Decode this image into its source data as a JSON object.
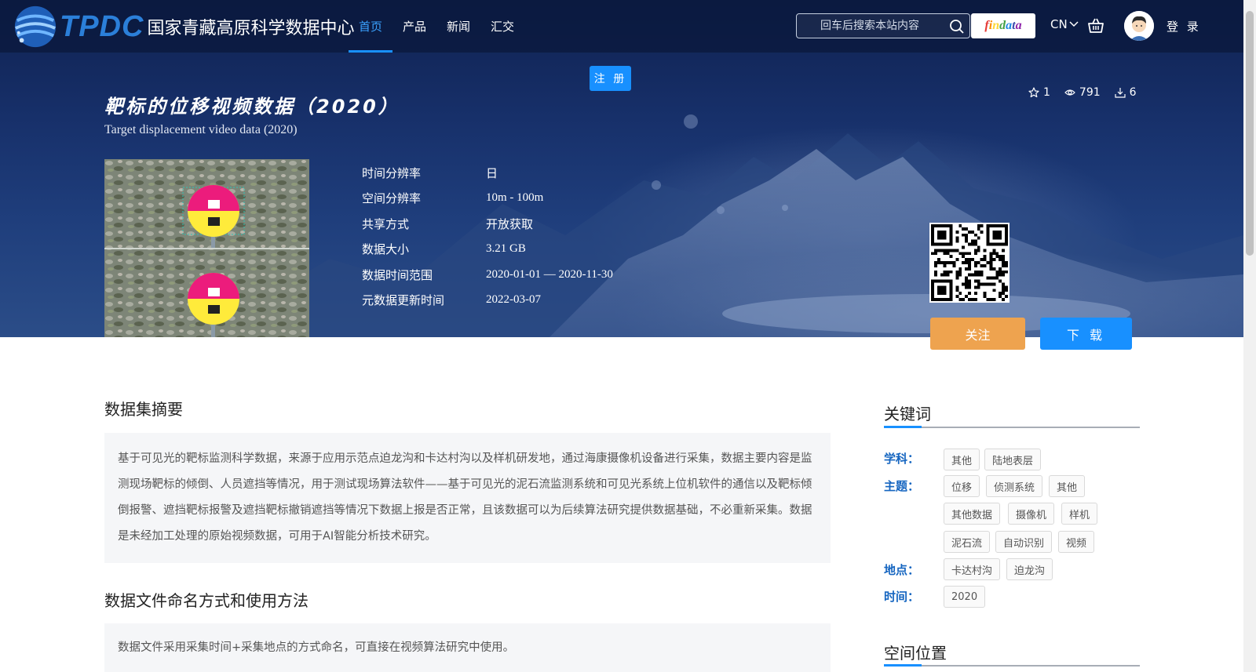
{
  "nav": {
    "logo_tpdc": "TPDC",
    "logo_cn": "国家青藏高原科学数据中心",
    "menu": [
      {
        "label": "首页",
        "active": true
      },
      {
        "label": "产品",
        "active": false
      },
      {
        "label": "新闻",
        "active": false
      },
      {
        "label": "汇交",
        "active": false
      }
    ],
    "search_placeholder": "回车后搜索本站内容",
    "findata_letters": [
      "f",
      "i",
      "n",
      "d",
      "a",
      "t",
      "a"
    ],
    "lang": "CN",
    "login": "登 录",
    "register": "注 册"
  },
  "dataset": {
    "title_cn": "靶标的位移视频数据（2020）",
    "title_en": "Target displacement video data (2020)",
    "stats": {
      "stars": "1",
      "views": "791",
      "downloads": "6"
    },
    "meta": [
      {
        "key": "时间分辨率",
        "value": "日"
      },
      {
        "key": "空间分辨率",
        "value": "10m - 100m"
      },
      {
        "key": "共享方式",
        "value": "开放获取"
      },
      {
        "key": "数据大小",
        "value": "3.21 GB"
      },
      {
        "key": "数据时间范围",
        "value": "2020-01-01 — 2020-11-30"
      },
      {
        "key": "元数据更新时间",
        "value": "2022-03-07"
      }
    ],
    "follow": "关注",
    "download": "下 载"
  },
  "abstract": {
    "title": "数据集摘要",
    "text": "基于可见光的靶标监测科学数据，来源于应用示范点迫龙沟和卡达村沟以及样机研发地，通过海康摄像机设备进行采集，数据主要内容是监测现场靶标的倾倒、人员遮挡等情况，用于测试现场算法软件——基于可见光的泥石流监测系统和可见光系统上位机软件的通信以及靶标倾倒报警、遮挡靶标报警及遮挡靶标撤销遮挡等情况下数据上报是否正常，且该数据可以为后续算法研究提供数据基础，不必重新采集。数据是未经加工处理的原始视频数据，可用于AI智能分析技术研究。"
  },
  "usage": {
    "title": "数据文件命名方式和使用方法",
    "text": "数据文件采用采集时间+采集地点的方式命名，可直接在视频算法研究中使用。"
  },
  "keywords": {
    "title": "关键词",
    "subject_label": "学科：",
    "subject": [
      "其他",
      "陆地表层"
    ],
    "theme_label": "主题：",
    "theme": [
      "位移",
      "侦测系统",
      "其他",
      "其他数据",
      "摄像机",
      "样机",
      "泥石流",
      "自动识别",
      "视频"
    ],
    "place_label": "地点：",
    "place": [
      "卡达村沟",
      "迫龙沟"
    ],
    "time_label": "时间：",
    "time": [
      "2020"
    ]
  },
  "spatial": {
    "title": "空间位置"
  }
}
